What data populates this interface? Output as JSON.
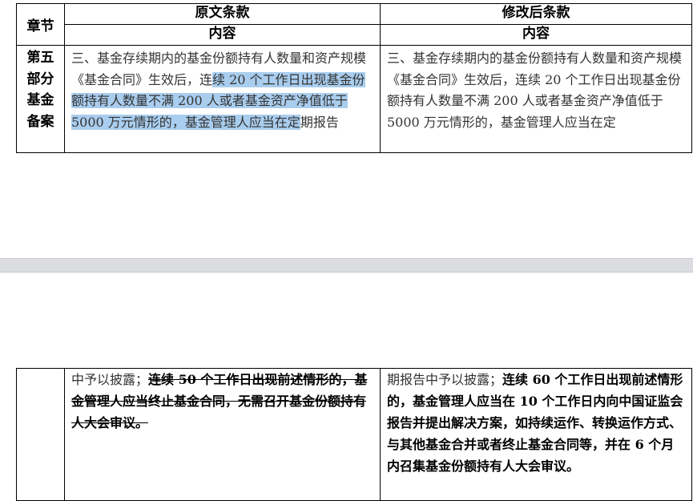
{
  "table_header": {
    "chapter": "章节",
    "original": "原文条款",
    "revised": "修改后条款",
    "content_orig": "内容",
    "content_rev": "内容"
  },
  "row": {
    "chapter_lines": [
      "第五",
      "部分",
      "基金",
      "备案"
    ],
    "original": {
      "heading": "三、基金存续期内的基金份额持有人数量和资产规模",
      "para_plain": "《基金合同》生效后，连",
      "para_highlight": "续 20 个工作日出现基金份额持有人数量不满 200 人或者基金资产净值低于 5000 万元情形的，基金管理人应当在定",
      "para_tail": "期报告"
    },
    "revised": {
      "heading": "三、基金存续期内的基金份额持有人数量和资产规模",
      "para": "《基金合同》生效后，连续 20 个工作日出现基金份额持有人数量不满 200 人或者基金资产净值低于 5000 万元情形的，基金管理人应当在定"
    }
  },
  "continued": {
    "original_plain": "中予以披露；",
    "original_strike": "连续 50 个工作日出现前述情形的，基金管理人应当终止基金合同，无需召开基金份额持有人大会审议。",
    "revised_plain": "期报告中予以披露；",
    "revised_bold": "连续 60 个工作日出现前述情形的，基金管理人应当在 10 个工作日内向中国证监会报告并提出解决方案，如持续运作、转换运作方式、与其他基金合并或者终止基金合同等，并在 6 个月内召集基金份额持有人大会审议。"
  }
}
